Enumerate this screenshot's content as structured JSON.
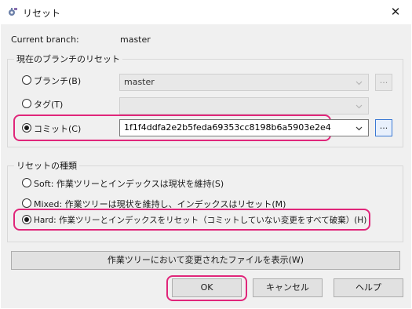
{
  "window": {
    "title": "リセット",
    "app_icon": "gear-icon",
    "close_glyph": "✕"
  },
  "branch": {
    "label": "Current branch:",
    "value": "master"
  },
  "target_group": {
    "title": "現在のブランチのリセット",
    "branch_option": {
      "label": "ブランチ(B)",
      "selected": false,
      "combo_value": "master"
    },
    "tag_option": {
      "label": "タグ(T)",
      "selected": false,
      "combo_value": ""
    },
    "commit_option": {
      "label": "コミット(C)",
      "selected": true,
      "combo_value": "1f1f4ddfa2e2b5feda69353cc8198b6a5903e2e4"
    },
    "browse_label": "..."
  },
  "type_group": {
    "title": "リセットの種類",
    "soft": {
      "label": "Soft: 作業ツリーとインデックスは現状を維持(S)",
      "selected": false
    },
    "mixed": {
      "label": "Mixed: 作業ツリーは現状を維持し、インデックスはリセット(M)",
      "selected": false
    },
    "hard": {
      "label": "Hard: 作業ツリーとインデックスをリセット（コミットしていない変更をすべて破棄）(H)",
      "selected": true
    }
  },
  "show_changes_label": "作業ツリーにおいて変更されたファイルを表示(W)",
  "buttons": {
    "ok": "OK",
    "cancel": "キャンセル",
    "help": "ヘルプ"
  },
  "colors": {
    "highlight": "#e0267a",
    "dialog_bg": "#f0f0f0",
    "focus_blue": "#3a78d4"
  }
}
